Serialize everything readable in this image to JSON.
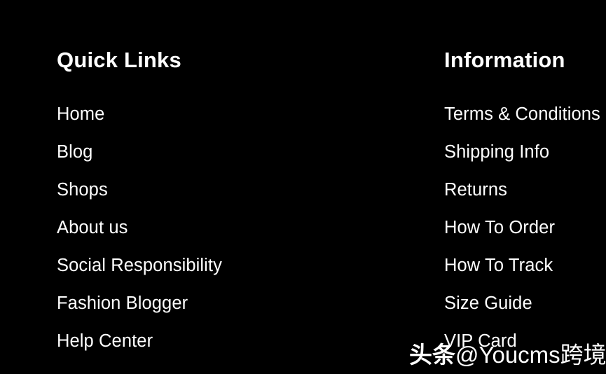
{
  "theme": {
    "background_color": "#000000",
    "text_color": "#ffffff"
  },
  "footer": {
    "columns": [
      {
        "heading": "Quick Links",
        "items": [
          "Home",
          "Blog",
          "Shops",
          "About us",
          "Social Responsibility",
          "Fashion Blogger",
          "Help Center"
        ]
      },
      {
        "heading": "Information",
        "items": [
          "Terms & Conditions",
          "Shipping Info",
          "Returns",
          "How To Order",
          "How To Track",
          "Size Guide",
          "VIP Card"
        ]
      }
    ]
  },
  "watermark": {
    "brand": "头条",
    "handle": "@Youcms跨境电商",
    "full_text": "头条 @Youcms跨境电商"
  }
}
